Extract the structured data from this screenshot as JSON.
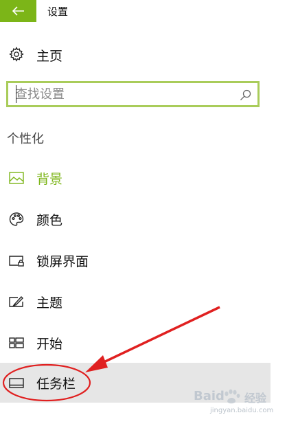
{
  "window": {
    "title": "设置"
  },
  "home": {
    "label": "主页",
    "icon": "gear-icon"
  },
  "search": {
    "value": "",
    "placeholder": "查找设置",
    "icon": "search-icon"
  },
  "section": {
    "heading": "个性化"
  },
  "nav": {
    "items": [
      {
        "label": "背景",
        "icon": "picture-icon",
        "state": "active"
      },
      {
        "label": "颜色",
        "icon": "palette-icon",
        "state": "normal"
      },
      {
        "label": "锁屏界面",
        "icon": "lock-screen-icon",
        "state": "normal"
      },
      {
        "label": "主题",
        "icon": "theme-icon",
        "state": "normal"
      },
      {
        "label": "开始",
        "icon": "start-icon",
        "state": "normal"
      },
      {
        "label": "任务栏",
        "icon": "taskbar-icon",
        "state": "selected"
      }
    ]
  },
  "watermark": {
    "brand": "Baid",
    "brand_cn": "经验",
    "url": "jingyan.baidu.com"
  },
  "colors": {
    "accent": "#7cb518",
    "search_border": "#a9cc5a",
    "selected_bg": "#e6e6e6",
    "annotation": "#e02020"
  }
}
